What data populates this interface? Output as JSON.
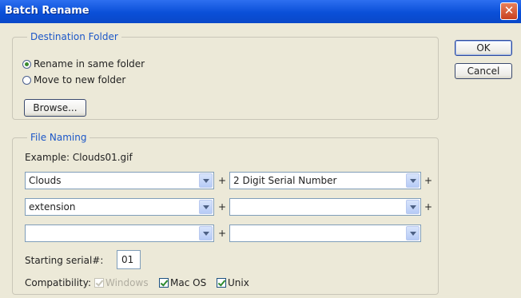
{
  "window": {
    "title": "Batch Rename",
    "close_glyph": "✕"
  },
  "destination": {
    "legend": "Destination Folder",
    "rename_same_label": "Rename in same folder",
    "rename_same_selected": true,
    "move_new_label": "Move to new folder",
    "move_new_selected": false,
    "browse_label": "Browse..."
  },
  "buttons": {
    "ok_label": "OK",
    "cancel_label": "Cancel"
  },
  "naming": {
    "legend": "File Naming",
    "example": "Example: Clouds01.gif",
    "rows": [
      {
        "left": "Clouds",
        "right": "2 Digit Serial Number",
        "plus1": "+",
        "plus2": "+"
      },
      {
        "left": "extension",
        "right": "",
        "plus1": "+",
        "plus2": "+"
      },
      {
        "left": "",
        "right": "",
        "plus1": "+",
        "plus2": ""
      }
    ],
    "serial_label": "Starting serial#:",
    "serial_value": "01",
    "compat_label": "Compatibility:",
    "windows_label": "Windows",
    "windows_checked": true,
    "windows_disabled": true,
    "macos_label": "Mac OS",
    "macos_checked": true,
    "unix_label": "Unix",
    "unix_checked": true
  }
}
